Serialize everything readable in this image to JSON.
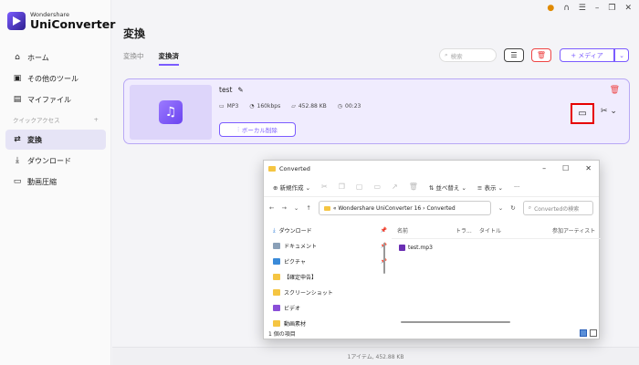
{
  "app": {
    "brand_small": "Wondershare",
    "brand_big": "UniConverter"
  },
  "sidebar": {
    "items": [
      {
        "label": "ホーム",
        "icon": "home-icon"
      },
      {
        "label": "その他のツール",
        "icon": "toolbox-icon"
      },
      {
        "label": "マイファイル",
        "icon": "file-icon"
      }
    ],
    "quick_access": {
      "label": "クイックアクセス",
      "add": "+"
    },
    "quick_items": [
      {
        "label": "変換",
        "icon": "convert-icon",
        "active": true
      },
      {
        "label": "ダウンロード",
        "icon": "download-icon"
      },
      {
        "label": "動画圧縮",
        "icon": "compress-icon"
      }
    ]
  },
  "header": {
    "title": "変換",
    "tabs": [
      {
        "label": "変換中"
      },
      {
        "label": "変換済"
      }
    ],
    "search_placeholder": "検索",
    "add_media_label": "+ メディア"
  },
  "file": {
    "name": "test",
    "format": "MP3",
    "bitrate": "160kbps",
    "size": "452.88 KB",
    "duration": "00:23",
    "vocal_remove_label": "ボーカル削除"
  },
  "footer": {
    "status": "1アイテム, 452.88 KB"
  },
  "explorer": {
    "title": "Converted",
    "new_label": "新規作成",
    "sort_label": "並べ替え",
    "view_label": "表示",
    "more": "···",
    "address": "« Wondershare UniConverter 16 › Converted",
    "search_placeholder": "Convertedの検索",
    "nav": [
      {
        "label": "ダウンロード",
        "pinned": true
      },
      {
        "label": "ドキュメント",
        "pinned": true
      },
      {
        "label": "ピクチャ",
        "pinned": true
      },
      {
        "label": "【確定申告】",
        "pinned": false
      },
      {
        "label": "スクリーンショット",
        "pinned": false
      },
      {
        "label": "ビデオ",
        "pinned": false
      },
      {
        "label": "動画素材",
        "pinned": false
      }
    ],
    "columns": [
      "名前",
      "トラ...",
      "タイトル",
      "参加アーティスト"
    ],
    "files": [
      {
        "name": "test.mp3"
      }
    ],
    "status": "1 個の項目"
  },
  "colors": {
    "accent": "#7b5cff",
    "highlight": "#e60000",
    "danger": "#e44444"
  }
}
